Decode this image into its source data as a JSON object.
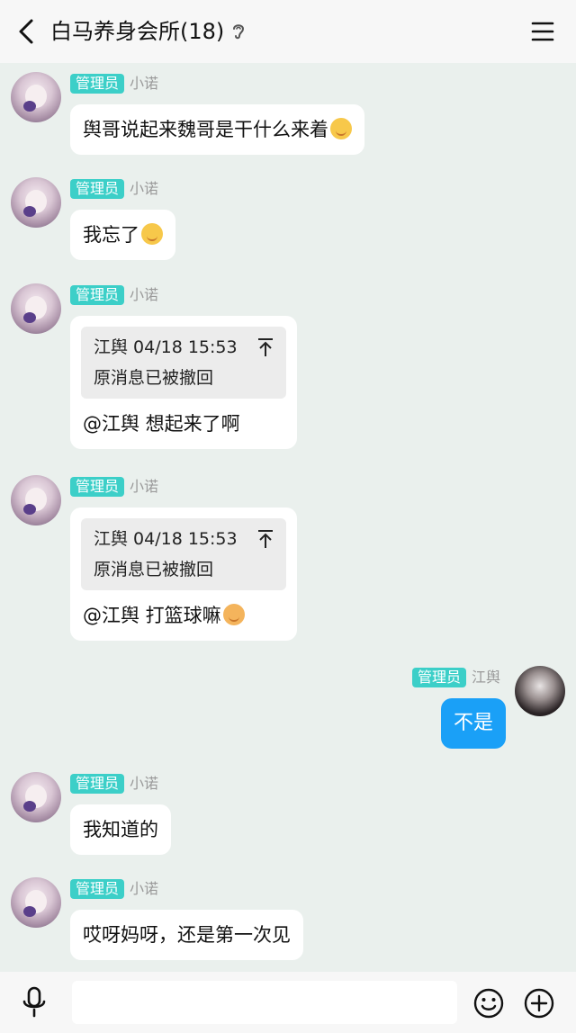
{
  "header": {
    "title": "白马养身会所(18)",
    "back_icon": "chevron-left-icon",
    "ear_icon": "ear-icon",
    "menu_icon": "menu-icon"
  },
  "messages": [
    {
      "badge": "管理员",
      "name": "小诺",
      "text": "舆哥说起来魏哥是干什么来着",
      "emoji": "smile-emoji"
    },
    {
      "badge": "管理员",
      "name": "小诺",
      "text": "我忘了",
      "emoji": "smile-emoji"
    },
    {
      "badge": "管理员",
      "name": "小诺",
      "quote_header": "江舆 04/18 15:53",
      "quote_body": "原消息已被撤回",
      "text": "@江舆 想起来了啊"
    },
    {
      "badge": "管理员",
      "name": "小诺",
      "quote_header": "江舆 04/18 15:53",
      "quote_body": "原消息已被撤回",
      "text": "@江舆 打篮球嘛",
      "emoji": "tiger-emoji"
    },
    {
      "badge": "管理员",
      "name": "江舆",
      "text": "不是",
      "self": true
    },
    {
      "badge": "管理员",
      "name": "小诺",
      "text": "我知道的"
    },
    {
      "badge": "管理员",
      "name": "小诺",
      "text": "哎呀妈呀，还是第一次见"
    }
  ],
  "input_bar": {
    "placeholder": "",
    "mic_icon": "microphone-icon",
    "emoji_icon": "emoji-face-icon",
    "plus_icon": "plus-circle-icon"
  },
  "colors": {
    "badge": "#3ccfc8",
    "self_bubble": "#1aa0f7",
    "chat_bg": "#eaf0ed"
  }
}
